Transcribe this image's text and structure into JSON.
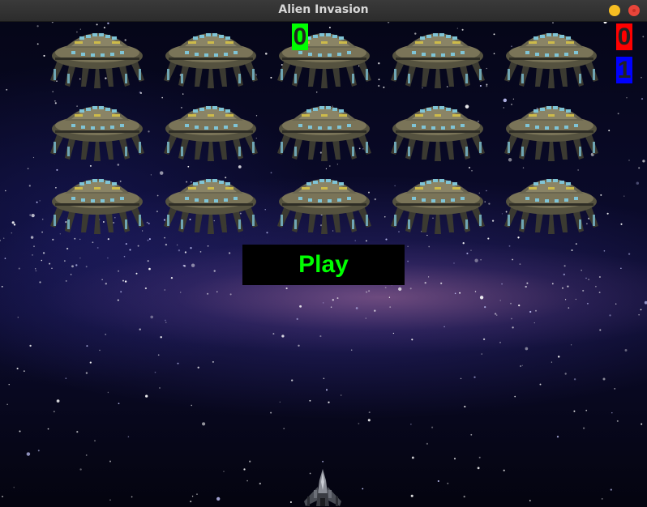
{
  "window": {
    "title": "Alien Invasion",
    "controls": [
      "minimize",
      "close"
    ],
    "colors": {
      "minimize": "#f6be22",
      "close": "#e9453a"
    }
  },
  "scoreboard": {
    "score": "0",
    "high_score": "0",
    "level": "1",
    "colors": {
      "score_bg": "#00ff00",
      "high_score_bg": "#ff0000",
      "level_bg": "#0000ff"
    }
  },
  "play_button": {
    "label": "Play",
    "colors": {
      "bg": "#000000",
      "text": "#00ff00"
    }
  },
  "fleet": {
    "rows": 3,
    "columns": 5,
    "icon": "alien-ufo-icon"
  },
  "player": {
    "icon": "spaceship-icon"
  },
  "background": {
    "icon": "starfield-milky-way"
  }
}
